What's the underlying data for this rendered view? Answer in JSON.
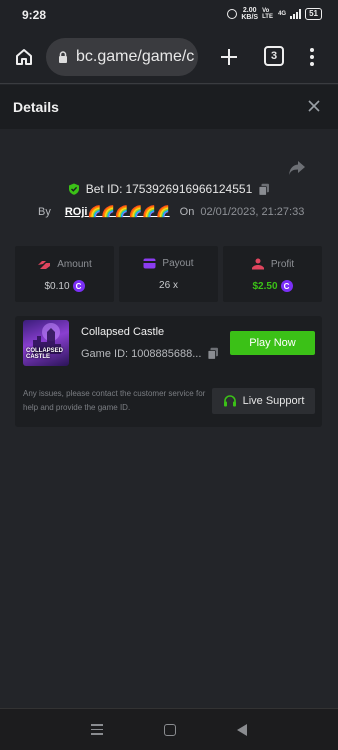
{
  "status_bar": {
    "time": "9:28",
    "speed_value": "2.00",
    "speed_unit": "KB/S",
    "net_label": "Vo LTE",
    "net_type": "4G",
    "battery": "51"
  },
  "browser": {
    "url": "bc.game/game/c",
    "tab_count": "3"
  },
  "details": {
    "title": "Details",
    "bet_id_label": "Bet ID:",
    "bet_id": "1753926916966124551",
    "by_label": "By",
    "user_name": "ROji🌈🌈🌈🌈🌈🌈",
    "on_label": "On",
    "date": "02/01/2023, 21:27:33"
  },
  "stats": {
    "amount_label": "Amount",
    "amount_value": "$0.10",
    "payout_label": "Payout",
    "payout_value": "26 x",
    "profit_label": "Profit",
    "profit_value": "$2.50",
    "coin_symbol": "C"
  },
  "game": {
    "thumb_text": "COLLAPSED CASTLE",
    "name": "Collapsed Castle",
    "id_label": "Game ID:",
    "id_value": "1008885688...",
    "play_label": "Play Now",
    "help_text": "Any issues, please contact the customer service for help and provide the game ID.",
    "support_label": "Live Support"
  },
  "colors": {
    "accent_green": "#3bc117",
    "coin_purple": "#7b2ff7",
    "background": "#232529"
  }
}
